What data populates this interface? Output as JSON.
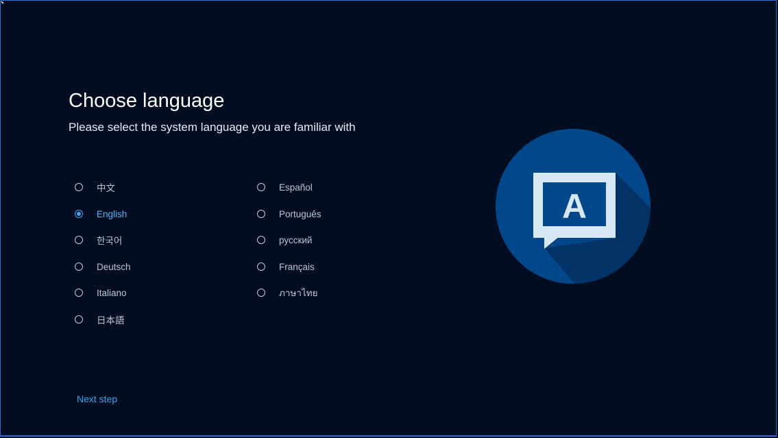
{
  "header": {
    "title": "Choose language",
    "subtitle": "Please select the system language you are familiar with"
  },
  "languages": [
    {
      "label": "中文",
      "selected": false
    },
    {
      "label": "English",
      "selected": true
    },
    {
      "label": "한국어",
      "selected": false
    },
    {
      "label": "Deutsch",
      "selected": false
    },
    {
      "label": "Italiano",
      "selected": false
    },
    {
      "label": "日本語",
      "selected": false
    },
    {
      "label": "Español",
      "selected": false
    },
    {
      "label": "Português",
      "selected": false
    },
    {
      "label": "русский",
      "selected": false
    },
    {
      "label": "Français",
      "selected": false
    },
    {
      "label": "ภาษาไทย",
      "selected": false
    }
  ],
  "illustration": {
    "icon": "language-speech-bubble-icon",
    "letter": "A"
  },
  "footer": {
    "next_label": "Next step"
  },
  "colors": {
    "background": "#020d21",
    "accent": "#3ea3ef",
    "circle": "#02478a",
    "bubble": "#d7e8f5"
  }
}
